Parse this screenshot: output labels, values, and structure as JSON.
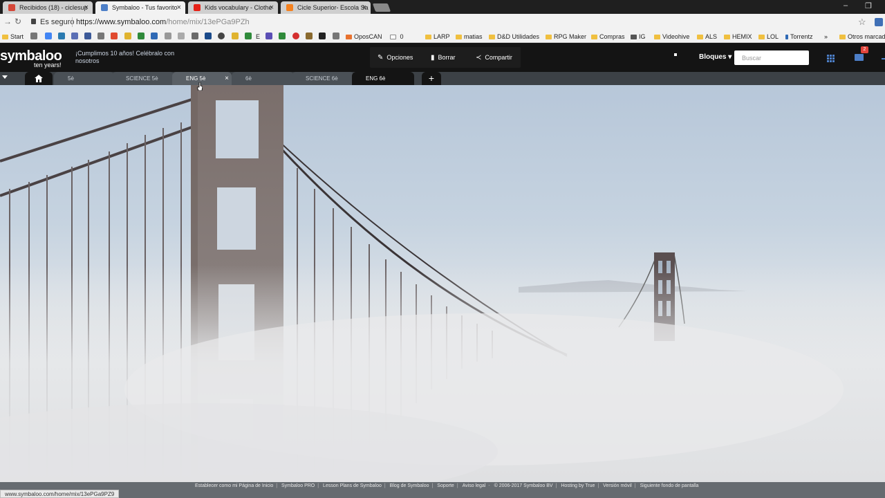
{
  "browser": {
    "tabs": [
      {
        "title": "Recibidos (18) - ciclesup",
        "favicon_color": "#d44638"
      },
      {
        "title": "Symbaloo - Tus favorito",
        "favicon_color": "#4d7fc8"
      },
      {
        "title": "Kids vocabulary - Clothe",
        "favicon_color": "#e62117"
      },
      {
        "title": "Cicle Superior- Escola Sa",
        "favicon_color": "#f4811f"
      }
    ],
    "security_text": "Es seguro",
    "url_domain": "https://www.symbaloo.com",
    "url_path": "/home/mix/13ePGa9PZh",
    "bookmarks": {
      "start": "Start",
      "e": "E",
      "oposcan": "OposCAN",
      "zero": "0",
      "larp": "LARP",
      "matias": "matias",
      "dd": "D&D Utilidades",
      "rpg": "RPG Maker",
      "compras": "Compras",
      "ig": "IG",
      "videohive": "Videohive",
      "als": "ALS",
      "hemix": "HEMIX",
      "lol": "LOL",
      "torrentz": "Torrentz",
      "more": "»",
      "otros": "Otros marcad"
    }
  },
  "header": {
    "logo": "symbaloo",
    "logo_sub": "ten years!",
    "promo": "¡Cumplimos 10 años! Celébralo con nosotros",
    "opciones": "Opciones",
    "borrar": "Borrar",
    "compartir": "Compartir",
    "bloques": "Bloques ▾",
    "search_placeholder": "Buscar",
    "mail_badge": "2"
  },
  "tabs": {
    "t1": "5è",
    "t2": "SCIENCE 5è",
    "t3": "ENG 5è",
    "t4": "6è",
    "t5": "SCIENCE 6è",
    "t6": "ENG 6è",
    "add": "+",
    "close": "×"
  },
  "footer": {
    "links": [
      "Establecer como mi Página de Inicio",
      "Symbaloo PRO",
      "Lesson Plans de Symbaloo",
      "Blog de Symbaloo",
      "Soporte",
      "Aviso legal"
    ],
    "copyright": "© 2006-2017 Symbaloo BV",
    "links2": [
      "Hosting by True",
      "Versión móvil",
      "Siguiente fondo de pantalla"
    ],
    "status_url": "www.symbaloo.com/home/mix/13ePGa9PZ9"
  }
}
